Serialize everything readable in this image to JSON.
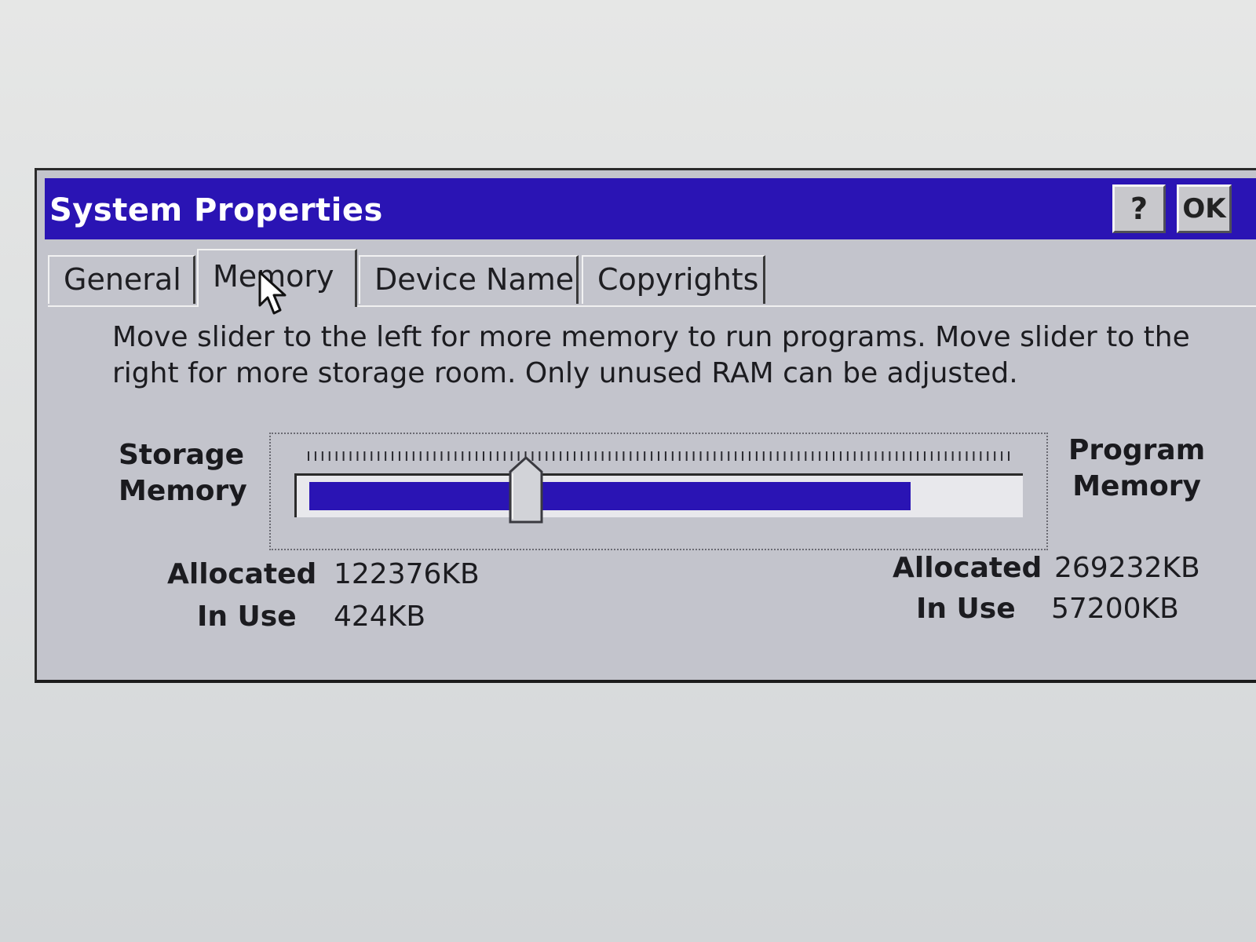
{
  "window": {
    "title": "System Properties",
    "help_label": "?",
    "ok_label": "OK",
    "title_color": "#2a14b4"
  },
  "tabs": [
    {
      "label": "General",
      "active": false
    },
    {
      "label": "Memory",
      "active": true
    },
    {
      "label": "Device Name",
      "active": false
    },
    {
      "label": "Copyrights",
      "active": false
    }
  ],
  "memory": {
    "description": "Move slider to the left for more memory to run programs. Move slider to the right for more storage room. Only unused RAM can be adjusted.",
    "storage_label_1": "Storage",
    "storage_label_2": "Memory",
    "program_label_1": "Program",
    "program_label_2": "Memory",
    "slider_position": 0.31,
    "slider_fill_fraction": 0.85,
    "storage": {
      "allocated_label": "Allocated",
      "allocated_value": "122376KB",
      "in_use_label": "In Use",
      "in_use_value": "424KB"
    },
    "program": {
      "allocated_label": "Allocated",
      "allocated_value": "269232KB",
      "in_use_label": "In Use",
      "in_use_value": "57200KB"
    }
  },
  "icons": {
    "cursor": "mouse-cursor-icon"
  }
}
